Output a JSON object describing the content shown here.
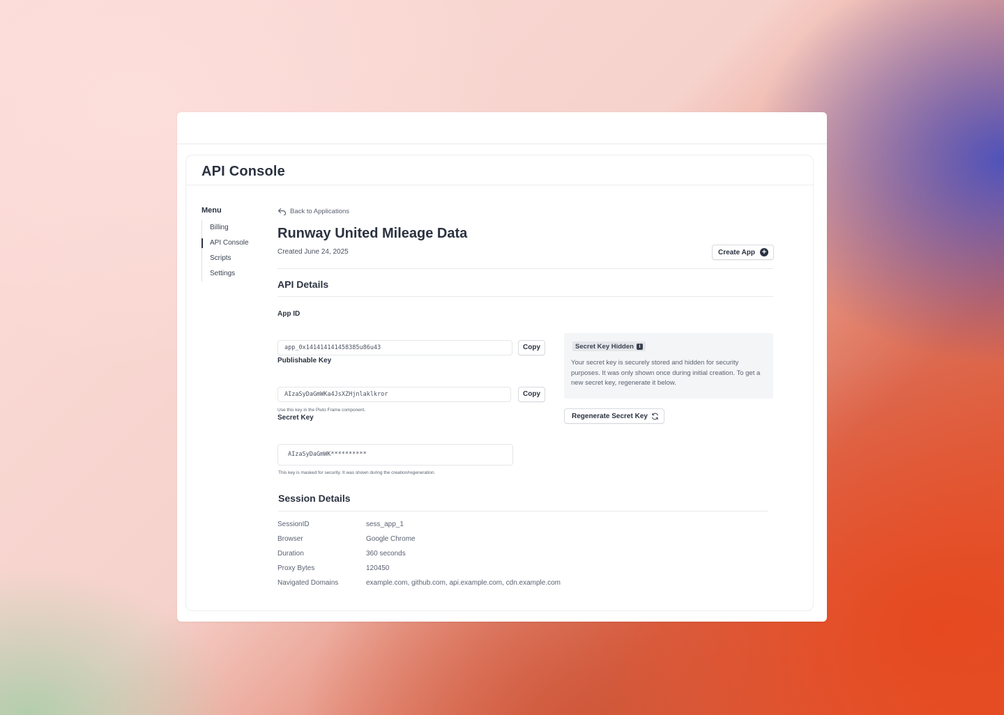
{
  "page": {
    "title": "API Console"
  },
  "menu": {
    "title": "Menu",
    "items": [
      {
        "label": "Billing",
        "active": false
      },
      {
        "label": "API Console",
        "active": true
      },
      {
        "label": "Scripts",
        "active": false
      },
      {
        "label": "Settings",
        "active": false
      }
    ]
  },
  "app": {
    "back_label": "Back to Applications",
    "name": "Runway United Mileage Data",
    "created": "Created June 24, 2025",
    "create_button": "Create App"
  },
  "api_details": {
    "title": "API Details",
    "app_id": {
      "label": "App ID",
      "value": "app_0x141414141458385u86u43",
      "copy_label": "Copy"
    },
    "publishable_key": {
      "label": "Publishable Key",
      "value": "AIzaSyDaGmWKa4JsXZHjnlaklkror",
      "copy_label": "Copy",
      "hint": "Use this key in the Pluto Frame component."
    },
    "secret_key": {
      "label": "Secret Key",
      "value": "AIzaSyDaGmWK**********",
      "hint": "This key is masked for security. It was shown during the creation/regeneration."
    },
    "secret_notice": {
      "badge": "Secret Key Hidden",
      "text": "Your secret key is securely stored and hidden for security purposes. It was only shown once during initial creation. To get a new secret key, regenerate it below."
    },
    "regenerate_button": "Regenerate Secret Key"
  },
  "session": {
    "title": "Session Details",
    "rows": [
      {
        "key": "SessionID",
        "value": "sess_app_1"
      },
      {
        "key": "Browser",
        "value": "Google Chrome"
      },
      {
        "key": "Duration",
        "value": "360 seconds"
      },
      {
        "key": "Proxy Bytes",
        "value": "120450"
      },
      {
        "key": "Navigated Domains",
        "value": "example.com, github.com, api.example.com, cdn.example.com"
      }
    ]
  },
  "icons": {
    "back": "back-arrow-icon",
    "create": "plus-circle-icon",
    "info": "info-icon",
    "regenerate": "refresh-icon"
  },
  "colors": {
    "text_primary": "#2b3240",
    "text_secondary": "#5a6170",
    "border": "#e4e6ea",
    "notice_bg": "#f4f5f7"
  }
}
